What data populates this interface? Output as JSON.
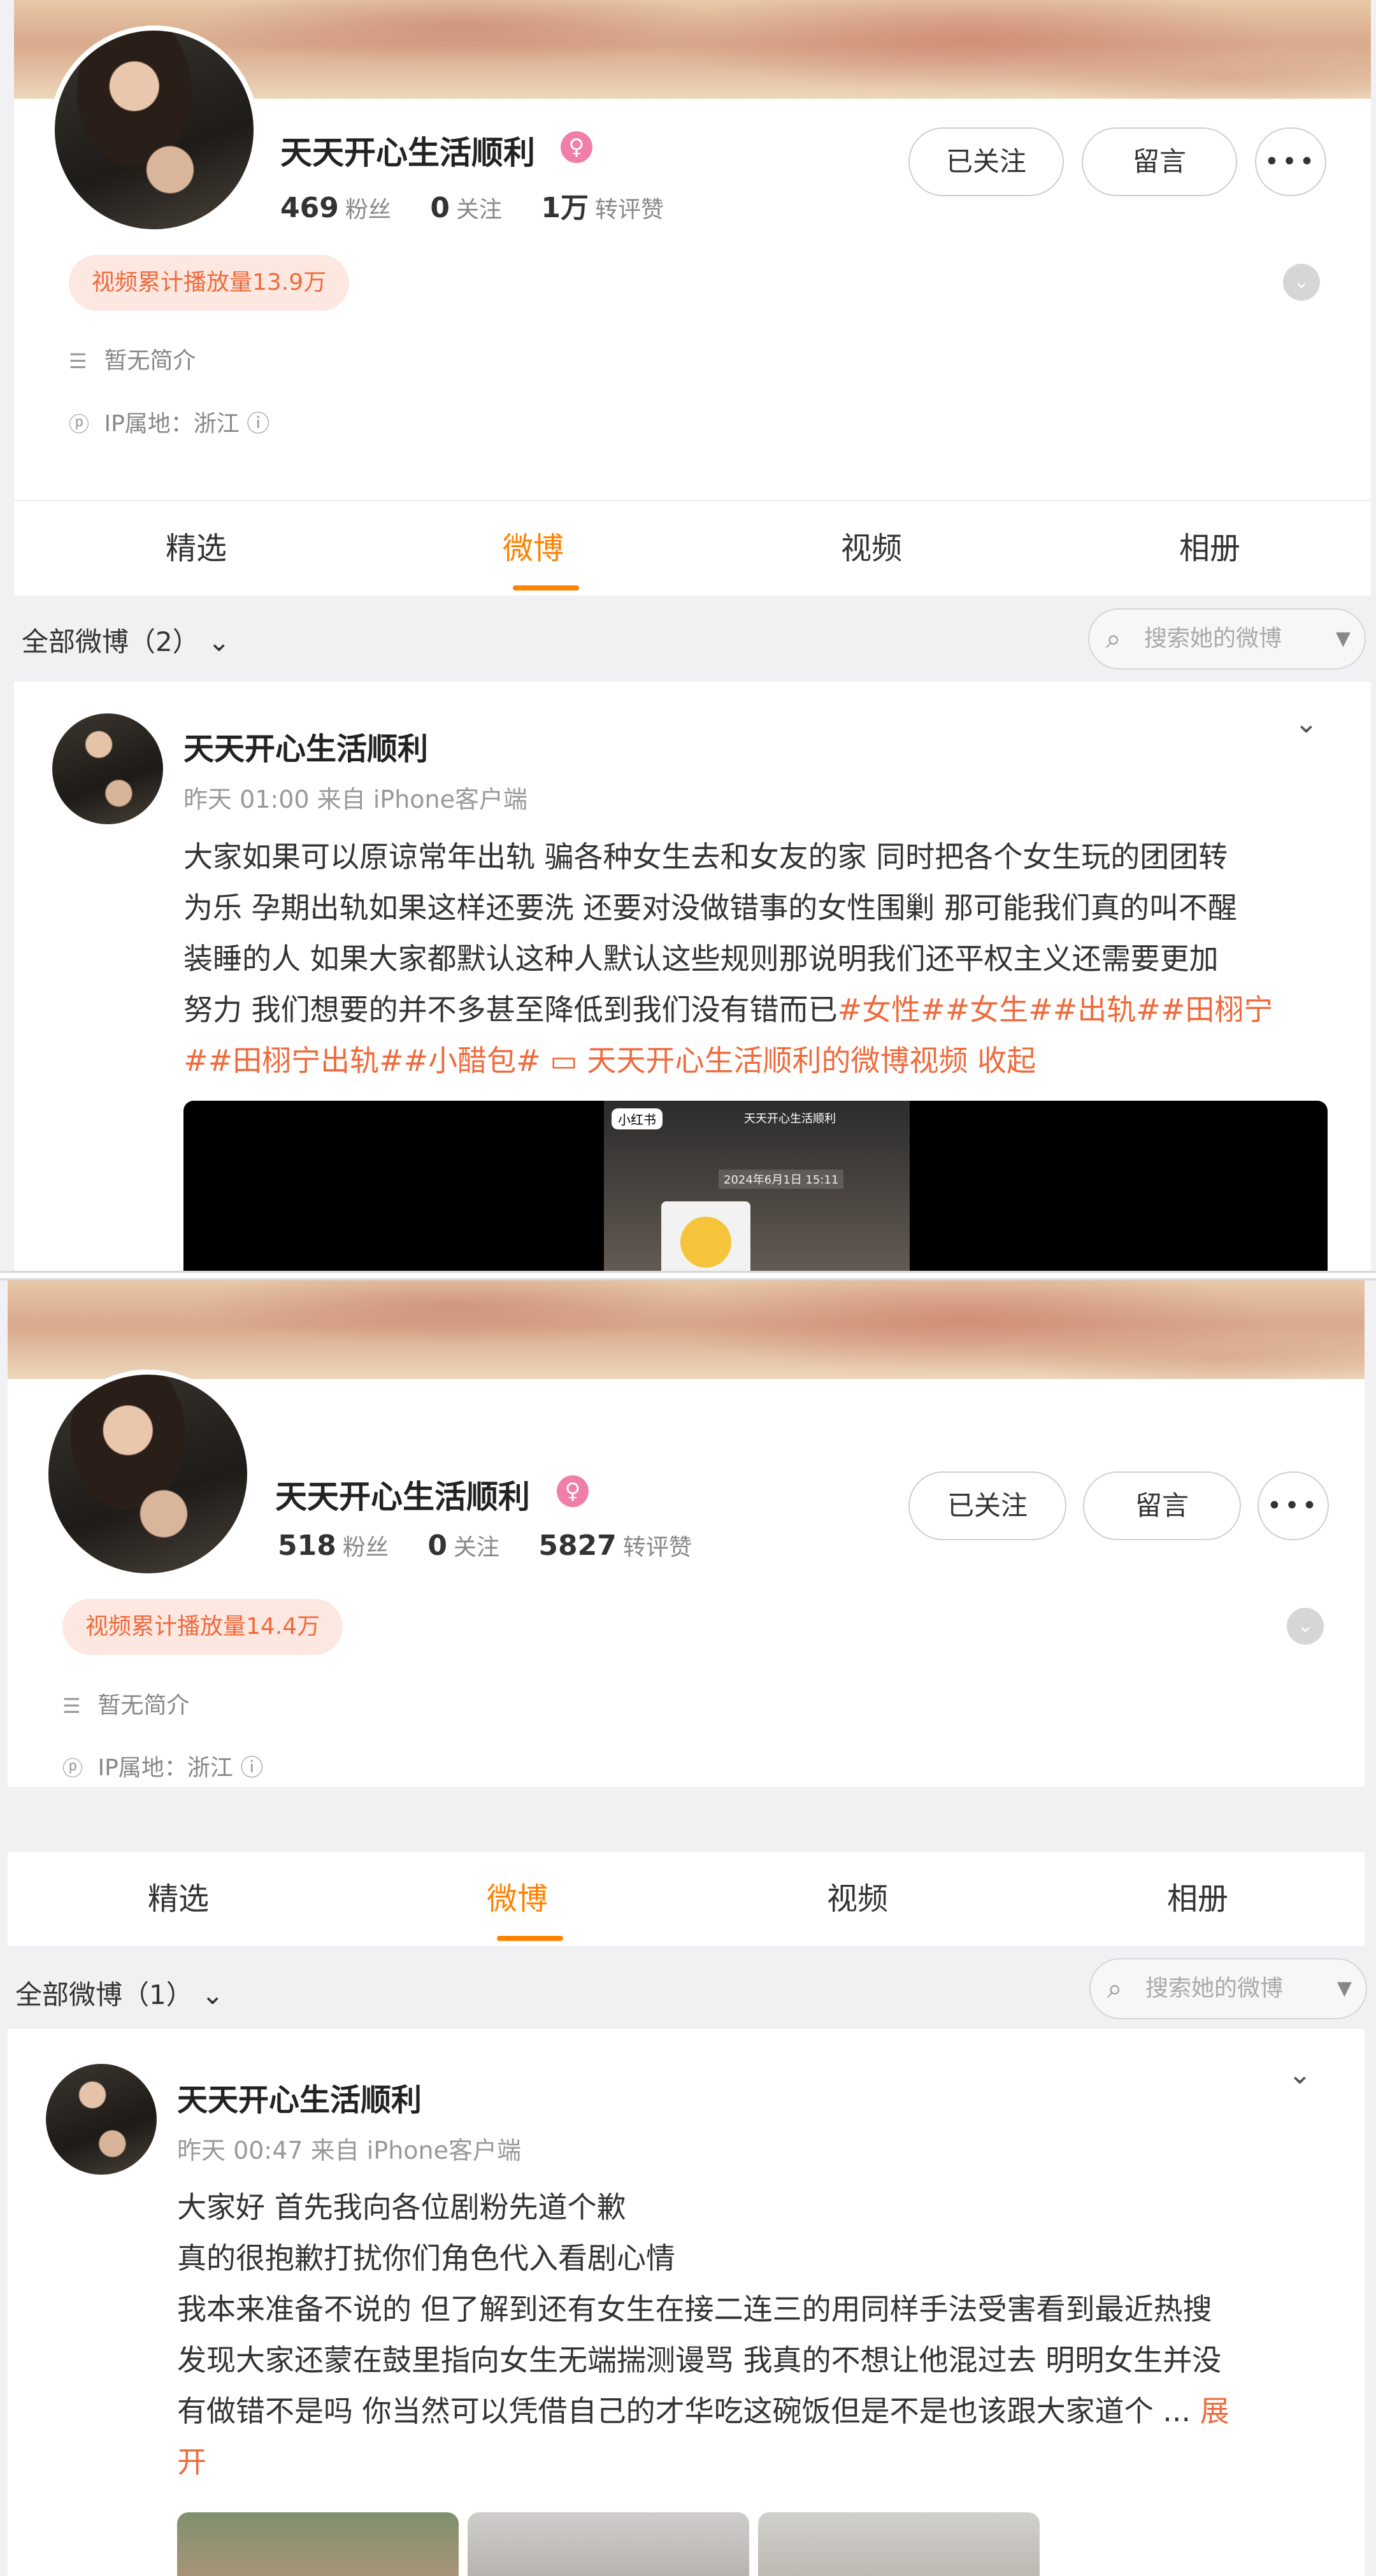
{
  "panels": [
    {
      "profile": {
        "name": "天天开心生活顺利",
        "badge_icon": "female-verified-icon",
        "followers_value": "469",
        "followers_label": "粉丝",
        "following_value": "0",
        "following_label": "关注",
        "likes_value": "1万",
        "likes_label": "转评赞",
        "follow_button": "已关注",
        "message_button": "留言",
        "more_button": "•••",
        "video_plays": "视频累计播放量13.9万",
        "bio": "暂无简介",
        "ip_location": "IP属地：浙江"
      },
      "tabs": [
        "精选",
        "微博",
        "视频",
        "相册"
      ],
      "active_tab": "微博",
      "filter_label": "全部微博（2）",
      "search_placeholder": "搜索她的微博",
      "post": {
        "author": "天天开心生活顺利",
        "time_source": "昨天 01:00  来自 iPhone客户端",
        "lines": [
          "大家如果可以原谅常年出轨 骗各种女生去和女友的家 同时把各个女生玩的团团转",
          "为乐 孕期出轨如果这样还要洗 还要对没做错事的女性围剿 那可能我们真的叫不醒",
          "装睡的人 如果大家都默认这种人默认这些规则那说明我们还平权主义还需要更加"
        ],
        "line4_plain": "努力 我们想要的并不多甚至降低到我们没有错而已",
        "line4_tags": "#女性##女生##出轨##田栩宁",
        "line5_tags": "##田栩宁出轨##小醋包# ",
        "video_link": "天天开心生活顺利的微博视频",
        "collapse": "收起",
        "video_thumb": {
          "logo": "小红书",
          "title": "天天开心生活顺利",
          "date": "2024年6月1日 15:11"
        }
      }
    },
    {
      "profile": {
        "name": "天天开心生活顺利",
        "badge_icon": "female-verified-icon",
        "followers_value": "518",
        "followers_label": "粉丝",
        "following_value": "0",
        "following_label": "关注",
        "likes_value": "5827",
        "likes_label": "转评赞",
        "follow_button": "已关注",
        "message_button": "留言",
        "more_button": "•••",
        "video_plays": "视频累计播放量14.4万",
        "bio": "暂无简介",
        "ip_location": "IP属地：浙江"
      },
      "tabs": [
        "精选",
        "微博",
        "视频",
        "相册"
      ],
      "active_tab": "微博",
      "filter_label": "全部微博（1）",
      "search_placeholder": "搜索她的微博",
      "post": {
        "author": "天天开心生活顺利",
        "time_source": "昨天 00:47  来自 iPhone客户端",
        "lines": [
          "大家好 首先我向各位剧粉先道个歉",
          "真的很抱歉打扰你们角色代入看剧心情",
          "我本来准备不说的 但了解到还有女生在接二连三的用同样手法受害看到最近热搜",
          "发现大家还蒙在鼓里指向女生无端揣测谩骂 我真的不想让他混过去 明明女生并没",
          "有做错不是吗 你当然可以凭借自己的才华吃这碗饭但是不是也该跟大家道个"
        ],
        "ellipsis": "...",
        "expand_a": "展",
        "expand_b": "开"
      }
    }
  ]
}
